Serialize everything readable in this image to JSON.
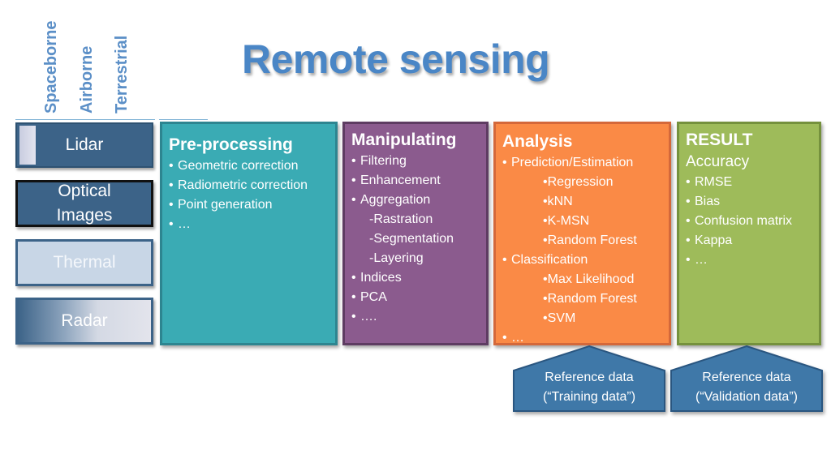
{
  "title": "Remote sensing",
  "platforms": [
    "Spaceborne",
    "Airborne",
    "Terrestrial"
  ],
  "sensors": [
    {
      "label": "Lidar"
    },
    {
      "label": "Optical Images"
    },
    {
      "label": "Thermal"
    },
    {
      "label": "Radar"
    }
  ],
  "stages": {
    "preprocessing": {
      "heading": "Pre-processing",
      "color": "#3aabb4",
      "items": [
        "Geometric correction",
        "Radiometric correction",
        "Point generation",
        "…"
      ]
    },
    "manipulating": {
      "heading": "Manipulating",
      "color": "#8b5b8e",
      "items": [
        "Filtering",
        "Enhancement",
        "Aggregation"
      ],
      "sub_items": [
        "-Rastration",
        "-Segmentation",
        "-Layering"
      ],
      "items_after": [
        "Indices",
        "PCA",
        "…."
      ]
    },
    "analysis": {
      "heading": "Analysis",
      "color": "#fa8a46",
      "prediction": {
        "label": "Prediction/Estimation",
        "methods": [
          "Regression",
          "kNN",
          "K-MSN",
          "Random Forest"
        ]
      },
      "classification": {
        "label": "Classification",
        "methods": [
          "Max Likelihood",
          "Random Forest",
          "SVM"
        ]
      },
      "more": "…"
    },
    "result": {
      "heading": "RESULT",
      "color": "#9ebb5a",
      "subheading": "Accuracy",
      "items": [
        "RMSE",
        "Bias",
        "Confusion matrix",
        "Kappa",
        "…"
      ]
    }
  },
  "reference": [
    {
      "line1": "Reference data",
      "line2": "(“Training data”)"
    },
    {
      "line1": "Reference data",
      "line2": "(“Validation data”)"
    }
  ],
  "bullet": "•"
}
